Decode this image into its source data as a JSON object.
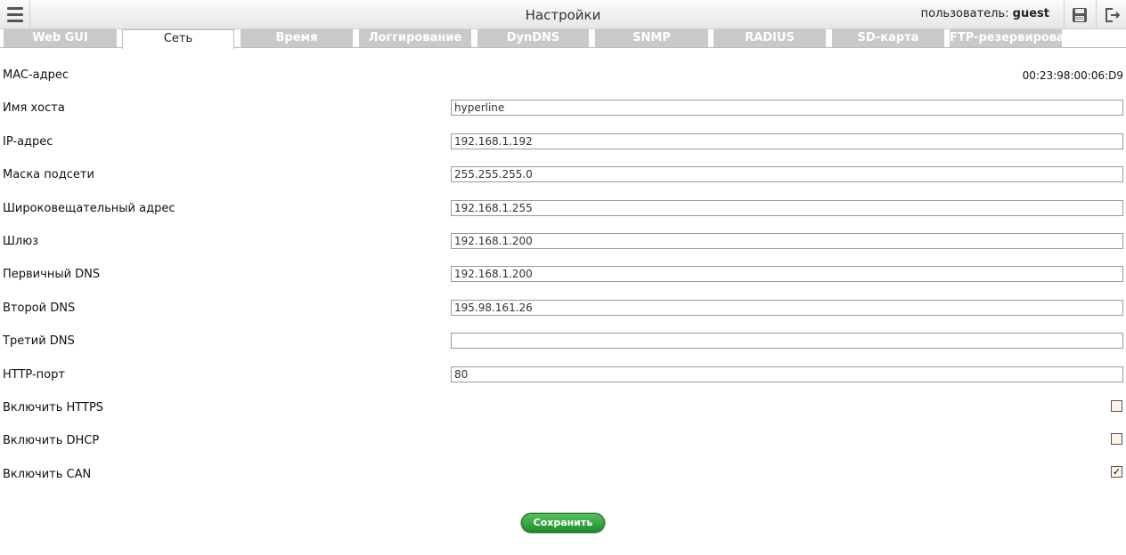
{
  "header": {
    "title": "Настройки",
    "user_label": "пользователь:",
    "user_name": "guest"
  },
  "tabs": [
    {
      "label": "Web GUI",
      "active": false
    },
    {
      "label": "Сеть",
      "active": true
    },
    {
      "label": "Время",
      "active": false
    },
    {
      "label": "Логгирование",
      "active": false
    },
    {
      "label": "DynDNS",
      "active": false
    },
    {
      "label": "SNMP",
      "active": false
    },
    {
      "label": "RADIUS",
      "active": false
    },
    {
      "label": "SD-карта",
      "active": false
    },
    {
      "label": "FTP-резервирование",
      "active": false
    }
  ],
  "form": {
    "mac": {
      "label": "MAC-адрес",
      "value": "00:23:98:00:06:D9"
    },
    "hostname": {
      "label": "Имя хоста",
      "value": "hyperline"
    },
    "ip": {
      "label": "IP-адрес",
      "value": "192.168.1.192"
    },
    "mask": {
      "label": "Маска подсети",
      "value": "255.255.255.0"
    },
    "broadcast": {
      "label": "Широковещательный адрес",
      "value": "192.168.1.255"
    },
    "gateway": {
      "label": "Шлюз",
      "value": "192.168.1.200"
    },
    "dns1": {
      "label": "Первичный DNS",
      "value": "192.168.1.200"
    },
    "dns2": {
      "label": "Второй DNS",
      "value": "195.98.161.26"
    },
    "dns3": {
      "label": "Третий DNS",
      "value": ""
    },
    "http_port": {
      "label": "HTTP-порт",
      "value": "80"
    },
    "https": {
      "label": "Включить HTTPS",
      "checked": false
    },
    "dhcp": {
      "label": "Включить DHCP",
      "checked": false
    },
    "can": {
      "label": "Включить CAN",
      "checked": true,
      "mark": "✓"
    }
  },
  "save_label": "Сохранить"
}
